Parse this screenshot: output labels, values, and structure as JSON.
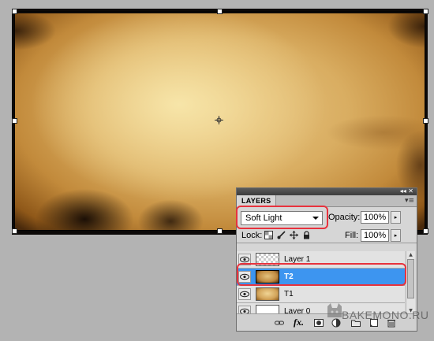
{
  "layers_panel": {
    "tab_label": "LAYERS",
    "panel_controls": "◂◂ ✕",
    "menu_icon": "panel-menu-icon",
    "blend_mode": "Soft Light",
    "opacity_label": "Opacity:",
    "opacity_value": "100%",
    "lock_label": "Lock:",
    "fill_label": "Fill:",
    "fill_value": "100%",
    "layers": [
      {
        "name": "Layer 1",
        "thumbnail": "transparent",
        "selected": false
      },
      {
        "name": "T2",
        "thumbnail": "paper-texture",
        "selected": true
      },
      {
        "name": "T1",
        "thumbnail": "paper-texture",
        "selected": false
      },
      {
        "name": "Layer 0",
        "thumbnail": "white",
        "selected": false
      }
    ],
    "bottom_icons": [
      "link-icon",
      "fx-icon",
      "mask-icon",
      "adjustment-icon",
      "folder-icon",
      "new-layer-icon",
      "trash-icon"
    ],
    "fx_label": "fx."
  },
  "colors": {
    "selection_blue": "#3d95f0",
    "highlight_red": "#e8323d",
    "panel_gray": "#d6d6d6"
  },
  "watermark": "BAKEMONO.RU"
}
